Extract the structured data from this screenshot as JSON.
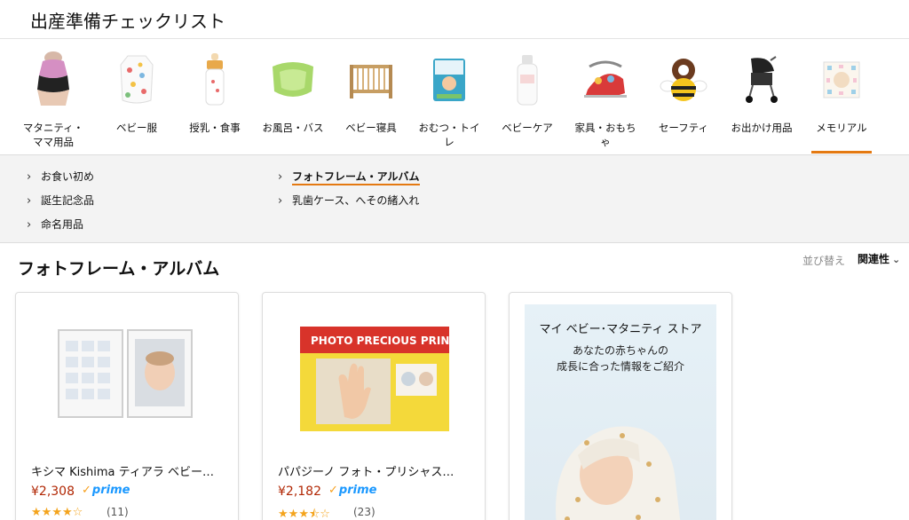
{
  "page_title": "出産準備チェックリスト",
  "categories": [
    {
      "label": "マタニティ・\nママ用品",
      "icon": "maternity-belt-icon"
    },
    {
      "label": "ベビー服",
      "icon": "baby-clothes-icon"
    },
    {
      "label": "授乳・食事",
      "icon": "baby-bottle-icon"
    },
    {
      "label": "お風呂・バス",
      "icon": "baby-bath-icon"
    },
    {
      "label": "ベビー寝具",
      "icon": "crib-icon"
    },
    {
      "label": "おむつ・トイ\nレ",
      "icon": "diaper-pack-icon"
    },
    {
      "label": "ベビーケア",
      "icon": "lotion-bottle-icon"
    },
    {
      "label": "家具・おもち\nゃ",
      "icon": "bouncer-icon"
    },
    {
      "label": "セーフティ",
      "icon": "bee-cushion-icon"
    },
    {
      "label": "お出かけ用品",
      "icon": "stroller-icon"
    },
    {
      "label": "メモリアル",
      "icon": "memorial-frame-icon"
    }
  ],
  "active_category": "メモリアル",
  "subcategories": {
    "left": [
      "お食い初め",
      "誕生記念品",
      "命名用品"
    ],
    "right": [
      "フォトフレーム・アルバム",
      "乳歯ケース、へその緒入れ"
    ]
  },
  "active_subcategory": "フォトフレーム・アルバム",
  "section_title": "フォトフレーム・アルバム",
  "sort": {
    "label": "並び替え",
    "value": "関連性",
    "icon": "chevron-down-icon"
  },
  "products": [
    {
      "title": "キシマ Kishima ティアラ ベビー…",
      "price": "¥2,308",
      "prime": "prime",
      "rating": 4,
      "reviews": "(11)"
    },
    {
      "title": "パパジーノ フォト・プリシャス…",
      "price": "¥2,182",
      "prime": "prime",
      "rating": 3.5,
      "reviews": "(23)"
    }
  ],
  "store_promo": {
    "title": "マイ ベビー･マタニティ ストア",
    "desc_line1": "あなたの赤ちゃんの",
    "desc_line2": "成長に合った情報をご紹介"
  },
  "colors": {
    "accent": "#e47911",
    "price": "#b12704",
    "prime": "#1a98ff",
    "star": "#f4a41d"
  }
}
